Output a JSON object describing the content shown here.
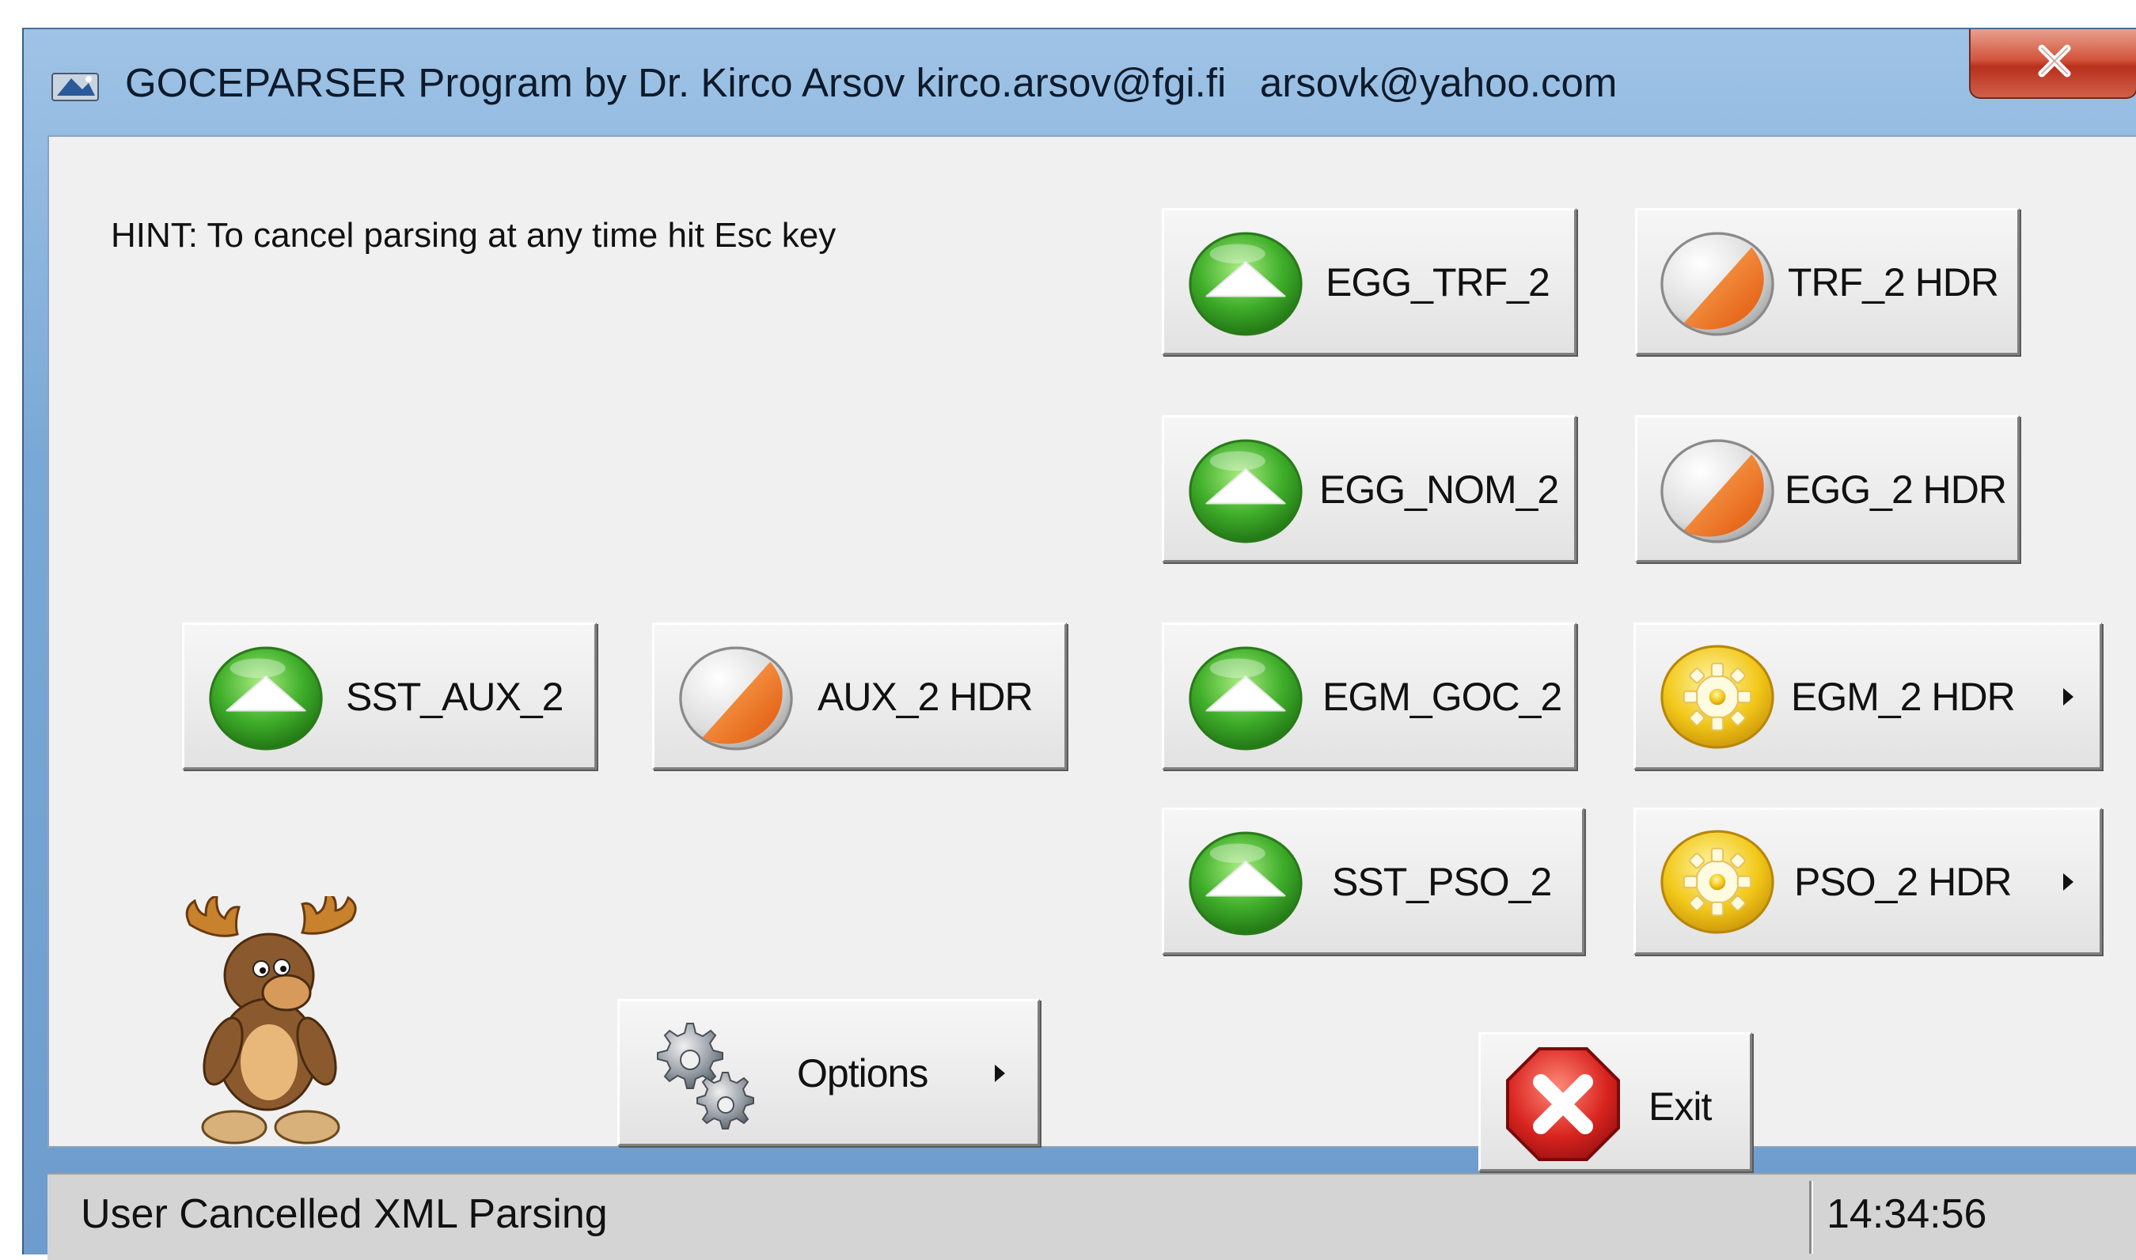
{
  "window": {
    "title": "GOCEPARSER Program by Dr. Kirco Arsov kirco.arsov@fgi.fi   arsovk@yahoo.com",
    "close_label": "X"
  },
  "hint": "HINT: To cancel parsing at any time hit Esc key",
  "buttons": {
    "egg_trf_2": {
      "label": "EGG_TRF_2",
      "icon": "green-up-orb-icon"
    },
    "trf_2_hdr": {
      "label": "TRF_2 HDR",
      "icon": "orange-half-orb-icon"
    },
    "egg_nom_2": {
      "label": "EGG_NOM_2",
      "icon": "green-up-orb-icon"
    },
    "egg_2_hdr": {
      "label": "EGG_2 HDR",
      "icon": "orange-half-orb-icon"
    },
    "sst_aux_2": {
      "label": "SST_AUX_2",
      "icon": "green-up-orb-icon"
    },
    "aux_2_hdr": {
      "label": "AUX_2 HDR",
      "icon": "orange-half-orb-icon"
    },
    "egm_goc_2": {
      "label": "EGM_GOC_2",
      "icon": "green-up-orb-icon"
    },
    "egm_2_hdr": {
      "label": "EGM_2 HDR",
      "icon": "yellow-gear-orb-icon",
      "has_submenu": true
    },
    "sst_pso_2": {
      "label": "SST_PSO_2",
      "icon": "green-up-orb-icon"
    },
    "pso_2_hdr": {
      "label": "PSO_2 HDR",
      "icon": "yellow-gear-orb-icon",
      "has_submenu": true
    },
    "options": {
      "label": "Options",
      "icon": "gears-icon",
      "has_submenu": true
    },
    "exit": {
      "label": "Exit",
      "icon": "red-stop-x-icon"
    }
  },
  "statusbar": {
    "message": "User Cancelled XML Parsing",
    "time": "14:34:56"
  },
  "colors": {
    "green": "#3fae2a",
    "orange": "#f07a1e",
    "yellow": "#f2c81a",
    "red": "#d8231e",
    "window_bg": "#f0f0f0"
  }
}
